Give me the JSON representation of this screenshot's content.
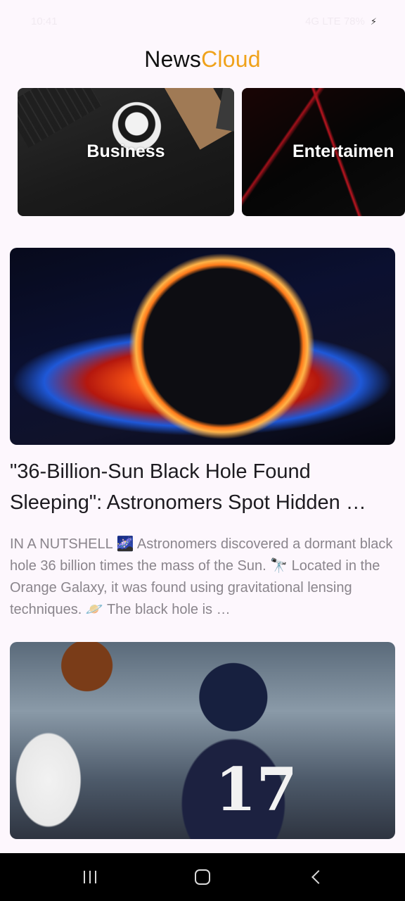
{
  "status_bar": {
    "time": "10:41",
    "right_text": "4G LTE 78%"
  },
  "app": {
    "title_part1": "News",
    "title_part2": "Cloud",
    "accent_color": "#f0a21a"
  },
  "categories": [
    {
      "label": "Business"
    },
    {
      "label": "Entertaimen"
    }
  ],
  "articles": [
    {
      "title": "\"36-Billion-Sun Black Hole Found Sleeping\": Astronomers Spot Hidden …",
      "summary": "IN A NUTSHELL 🌌 Astronomers discovered a dormant black hole 36 billion times the mass of the Sun. 🔭 Located in the Orange Galaxy, it was found using gravitational lensing techniques. 🪐 The black hole is …",
      "image_icon": "black-hole-image"
    },
    {
      "image_icon": "football-player-image",
      "jersey_number": "17"
    }
  ],
  "nav": {
    "recents_icon": "recents-icon",
    "home_icon": "home-icon",
    "back_icon": "back-icon"
  }
}
